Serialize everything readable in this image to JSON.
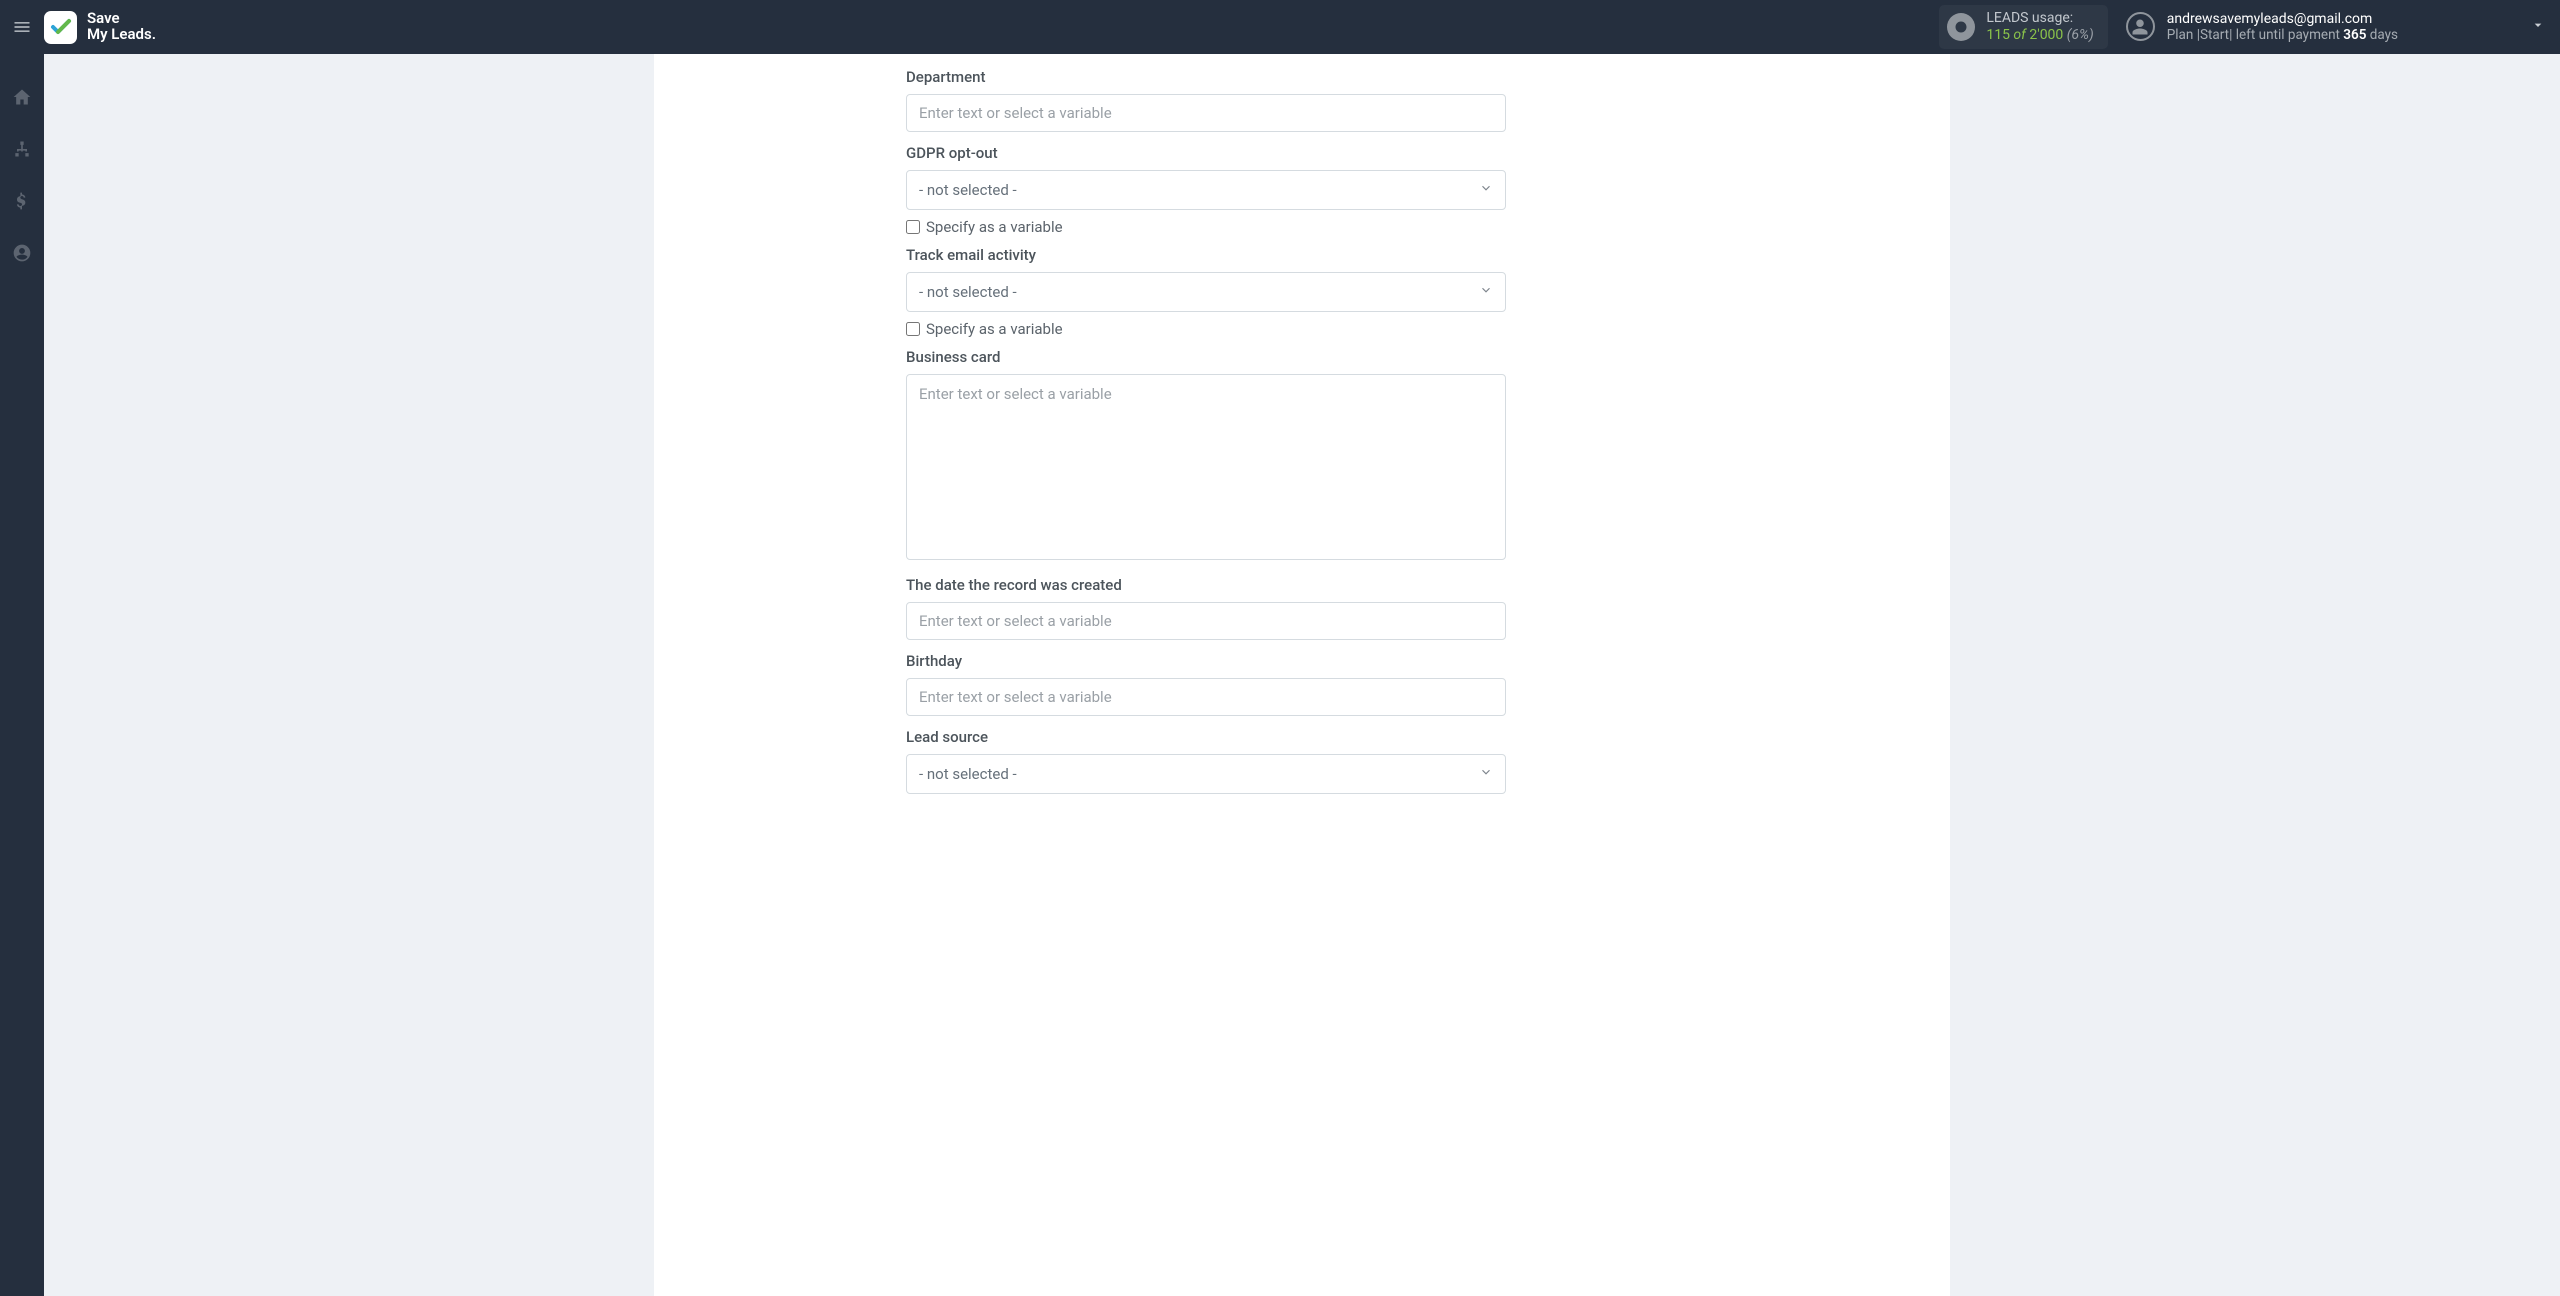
{
  "brand": {
    "line1": "Save",
    "line2": "My Leads."
  },
  "header": {
    "usage": {
      "label": "LEADS usage:",
      "current": "115",
      "of": "of",
      "total": "2'000",
      "pct": "(6%)"
    },
    "account": {
      "email": "andrewsavemyleads@gmail.com",
      "plan_prefix": "Plan |Start| left until payment ",
      "days": "365",
      "days_suffix": " days"
    }
  },
  "form": {
    "placeholder_text": "Enter text or select a variable",
    "not_selected": "- not selected -",
    "specify_variable": "Specify as a variable",
    "fields": {
      "department": {
        "label": "Department"
      },
      "gdpr": {
        "label": "GDPR opt-out"
      },
      "track_email": {
        "label": "Track email activity"
      },
      "business_card": {
        "label": "Business card"
      },
      "date_created": {
        "label": "The date the record was created"
      },
      "birthday": {
        "label": "Birthday"
      },
      "lead_source": {
        "label": "Lead source"
      }
    }
  }
}
